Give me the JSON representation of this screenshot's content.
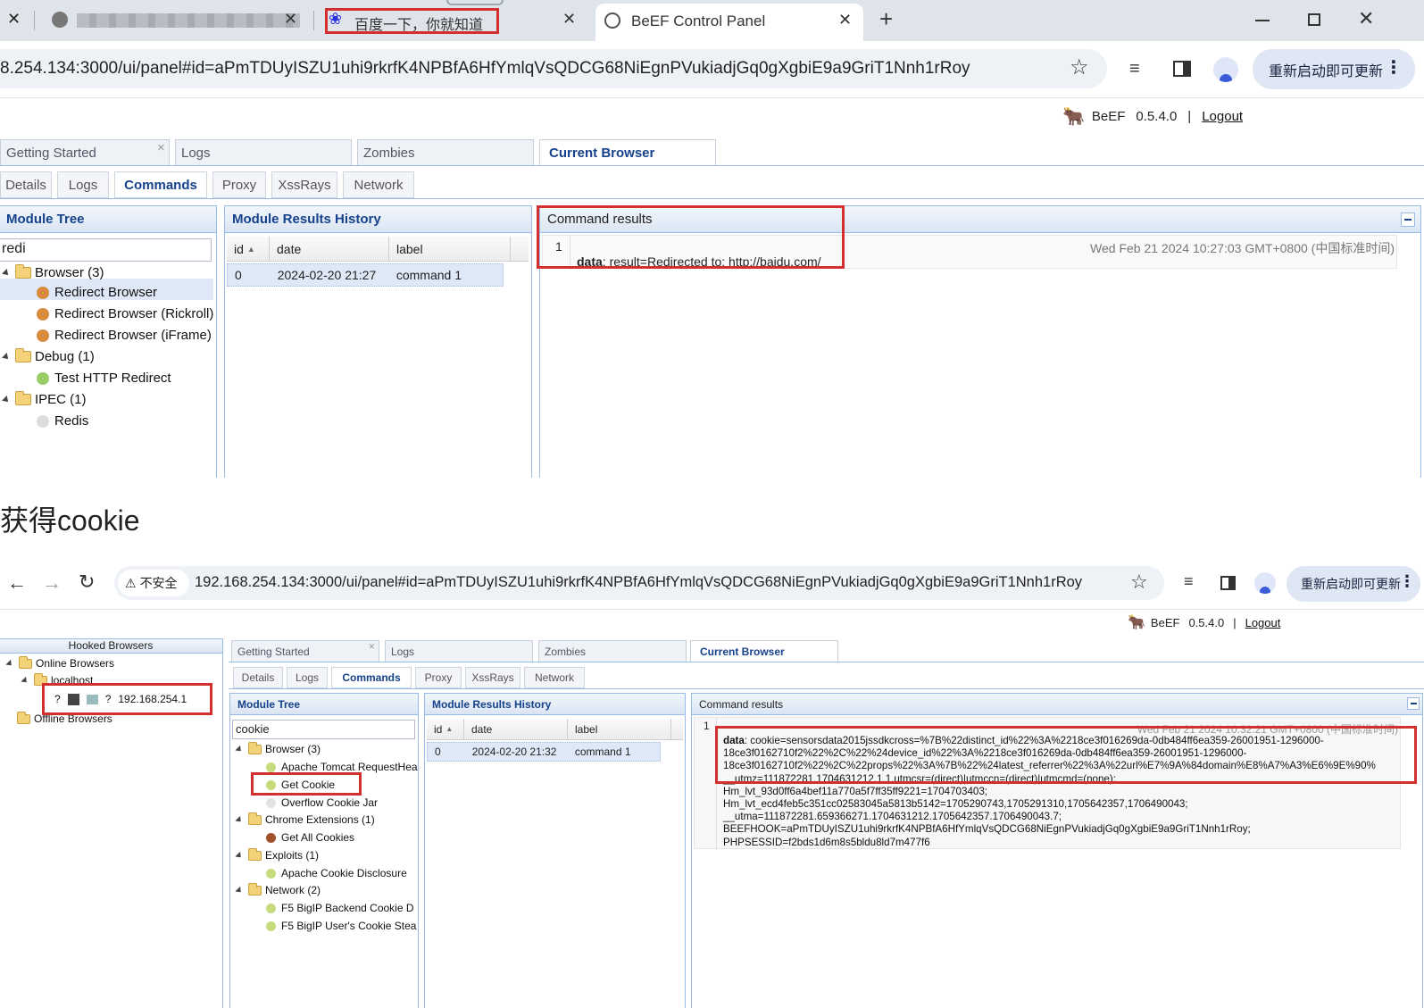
{
  "top": {
    "tabs": [
      {
        "label": "",
        "blurred": true
      },
      {
        "label": "百度一下，你就知道"
      },
      {
        "label": "BeEF Control Panel"
      }
    ],
    "new_tab": "+",
    "url": "8.254.134:3000/ui/panel#id=aPmTDUyISZU1uhi9rkrfK4NPBfA6HfYmlqVsQDCG68NiEgnPVukiadjGq0gXgbiE9a9GriT1Nnh1rRoy",
    "update_button": "重新启动即可更新",
    "beef": {
      "name": "BeEF",
      "version": "0.5.4.0",
      "separator": "|",
      "logout": "Logout"
    },
    "main_tabs": [
      "Getting Started",
      "Logs",
      "Zombies",
      "Current Browser"
    ],
    "sub_tabs": [
      "Details",
      "Logs",
      "Commands",
      "Proxy",
      "XssRays",
      "Network"
    ],
    "module_tree": {
      "title": "Module Tree",
      "search": "redi",
      "items": [
        {
          "type": "folder",
          "label": "Browser (3)"
        },
        {
          "type": "module",
          "label": "Redirect Browser",
          "status": "orange"
        },
        {
          "type": "module",
          "label": "Redirect Browser (Rickroll)",
          "status": "orange"
        },
        {
          "type": "module",
          "label": "Redirect Browser (iFrame)",
          "status": "orange"
        },
        {
          "type": "folder",
          "label": "Debug (1)"
        },
        {
          "type": "module",
          "label": "Test HTTP Redirect",
          "status": "green"
        },
        {
          "type": "folder",
          "label": "IPEC (1)"
        },
        {
          "type": "module",
          "label": "Redis",
          "status": "grey"
        }
      ]
    },
    "history": {
      "title": "Module Results History",
      "columns": [
        "id",
        "date",
        "label"
      ],
      "rows": [
        [
          "0",
          "2024-02-20 21:27",
          "command 1"
        ]
      ]
    },
    "results": {
      "title": "Command results",
      "index": "1",
      "timestamp": "Wed Feb 21 2024 10:27:03 GMT+0800 (中国标准时间)",
      "data_label": "data",
      "data_value": ": result=Redirected to: http://baidu.com/"
    }
  },
  "heading": "获得cookie",
  "bottom": {
    "insecure_label": "不安全",
    "url": "192.168.254.134:3000/ui/panel#id=aPmTDUyISZU1uhi9rkrfK4NPBfA6HfYmlqVsQDCG68NiEgnPVukiadjGq0gXgbiE9a9GriT1Nnh1rRoy",
    "update_button": "重新启动即可更新",
    "beef": {
      "name": "BeEF",
      "version": "0.5.4.0",
      "separator": "|",
      "logout": "Logout"
    },
    "hooked": {
      "title": "Hooked Browsers",
      "online": "Online Browsers",
      "localhost": "localhost",
      "ip": "192.168.254.1",
      "offline": "Offline Browsers",
      "unknown_glyph": "?"
    },
    "main_tabs": [
      "Getting Started",
      "Logs",
      "Zombies",
      "Current Browser"
    ],
    "sub_tabs": [
      "Details",
      "Logs",
      "Commands",
      "Proxy",
      "XssRays",
      "Network"
    ],
    "module_tree": {
      "title": "Module Tree",
      "search": "cookie",
      "items": [
        {
          "type": "folder",
          "label": "Browser (3)"
        },
        {
          "type": "module",
          "label": "Apache Tomcat RequestHea",
          "status": "green"
        },
        {
          "type": "module",
          "label": "Get Cookie",
          "status": "green"
        },
        {
          "type": "module",
          "label": "Overflow Cookie Jar",
          "status": "grey"
        },
        {
          "type": "folder",
          "label": "Chrome Extensions (1)"
        },
        {
          "type": "module",
          "label": "Get All Cookies",
          "status": "brown"
        },
        {
          "type": "folder",
          "label": "Exploits (1)"
        },
        {
          "type": "module",
          "label": "Apache Cookie Disclosure",
          "status": "green"
        },
        {
          "type": "folder",
          "label": "Network (2)"
        },
        {
          "type": "module",
          "label": "F5 BigIP Backend Cookie D",
          "status": "green"
        },
        {
          "type": "module",
          "label": "F5 BigIP User's Cookie Stea",
          "status": "green"
        }
      ]
    },
    "history": {
      "title": "Module Results History",
      "columns": [
        "id",
        "date",
        "label"
      ],
      "rows": [
        [
          "0",
          "2024-02-20 21:32",
          "command 1"
        ]
      ]
    },
    "results": {
      "title": "Command results",
      "index": "1",
      "timestamp": "Wed Feb 21 2024 10:32:21 GMT+0800 (中国标准时间)",
      "data_label": "data",
      "lines": [
        ": cookie=sensorsdata2015jssdkcross=%7B%22distinct_id%22%3A%2218ce3f016269da-0db484ff6ea359-26001951-1296000-",
        "18ce3f0162710f2%22%2C%22%24device_id%22%3A%2218ce3f016269da-0db484ff6ea359-26001951-1296000-",
        "18ce3f0162710f2%22%2C%22props%22%3A%7B%22%24latest_referrer%22%3A%22url%E7%9A%84domain%E8%A7%A3%E6%9E%90%",
        "__utmz=111872281.1704631212.1.1.utmcsr=(direct)|utmccn=(direct)|utmcmd=(none);",
        "Hm_lvt_93d0ff6a4bef11a770a5f7ff35ff9221=1704703403;",
        "Hm_lvt_ecd4feb5c351cc02583045a5813b5142=1705290743,1705291310,1705642357,1706490043;",
        "__utma=111872281.659366271.1704631212.1705642357.1706490043.7;",
        "BEEFHOOK=aPmTDUyISZU1uhi9rkrfK4NPBfA6HfYmlqVsQDCG68NiEgnPVukiadjGq0gXgbiE9a9GriT1Nnh1rRoy;",
        "PHPSESSID=f2bds1d6m8s5bldu8ld7m477f6"
      ]
    }
  },
  "colors": {
    "highlight": "#d32f2f",
    "accent_text": "#15428b",
    "panel_border": "#99bbe8",
    "tabstrip": "#dfe3ea"
  }
}
